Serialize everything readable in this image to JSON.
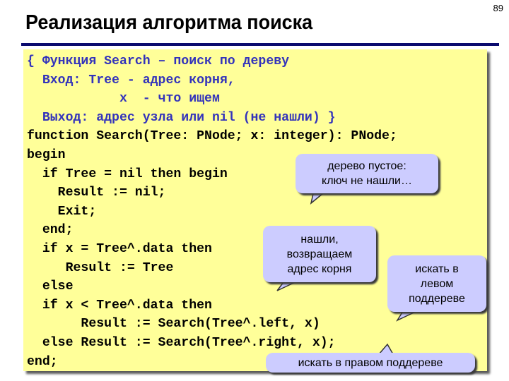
{
  "page": {
    "number": "89",
    "title": "Реализация алгоритма поиска"
  },
  "code": {
    "lines": [
      {
        "text": "{ Функция Search – поиск по дереву",
        "kind": "comment"
      },
      {
        "text": "  Вход: Tree - адрес корня,",
        "kind": "comment"
      },
      {
        "text": "            x  - что ищем",
        "kind": "comment"
      },
      {
        "text": "  Выход: адрес узла или nil (не нашли) }",
        "kind": "comment"
      },
      {
        "text": "function Search(Tree: PNode; x: integer): PNode;",
        "kind": "code"
      },
      {
        "text": "begin",
        "kind": "code"
      },
      {
        "text": "  if Tree = nil then begin",
        "kind": "code"
      },
      {
        "text": "    Result := nil;",
        "kind": "code"
      },
      {
        "text": "    Exit;",
        "kind": "code"
      },
      {
        "text": "  end;",
        "kind": "code"
      },
      {
        "text": "  if x = Tree^.data then",
        "kind": "code"
      },
      {
        "text": "     Result := Tree",
        "kind": "code"
      },
      {
        "text": "  else",
        "kind": "code"
      },
      {
        "text": "  if x < Tree^.data then",
        "kind": "code"
      },
      {
        "text": "       Result := Search(Tree^.left, x)",
        "kind": "code"
      },
      {
        "text": "  else Result := Search(Tree^.right, x);",
        "kind": "code"
      },
      {
        "text": "end;",
        "kind": "code"
      }
    ]
  },
  "callouts": {
    "empty_tree": [
      "дерево пустое:",
      "ключ не нашли…"
    ],
    "found": [
      "нашли,",
      "возвращаем",
      "адрес корня"
    ],
    "search_left": [
      "искать в",
      "левом",
      "поддереве"
    ],
    "search_right": [
      "искать в правом поддереве"
    ]
  },
  "colors": {
    "code_background": "#ffff99",
    "comment_text": "#3333bb",
    "callout_background": "#ccccff",
    "title_rule": "#0a0a6e"
  }
}
